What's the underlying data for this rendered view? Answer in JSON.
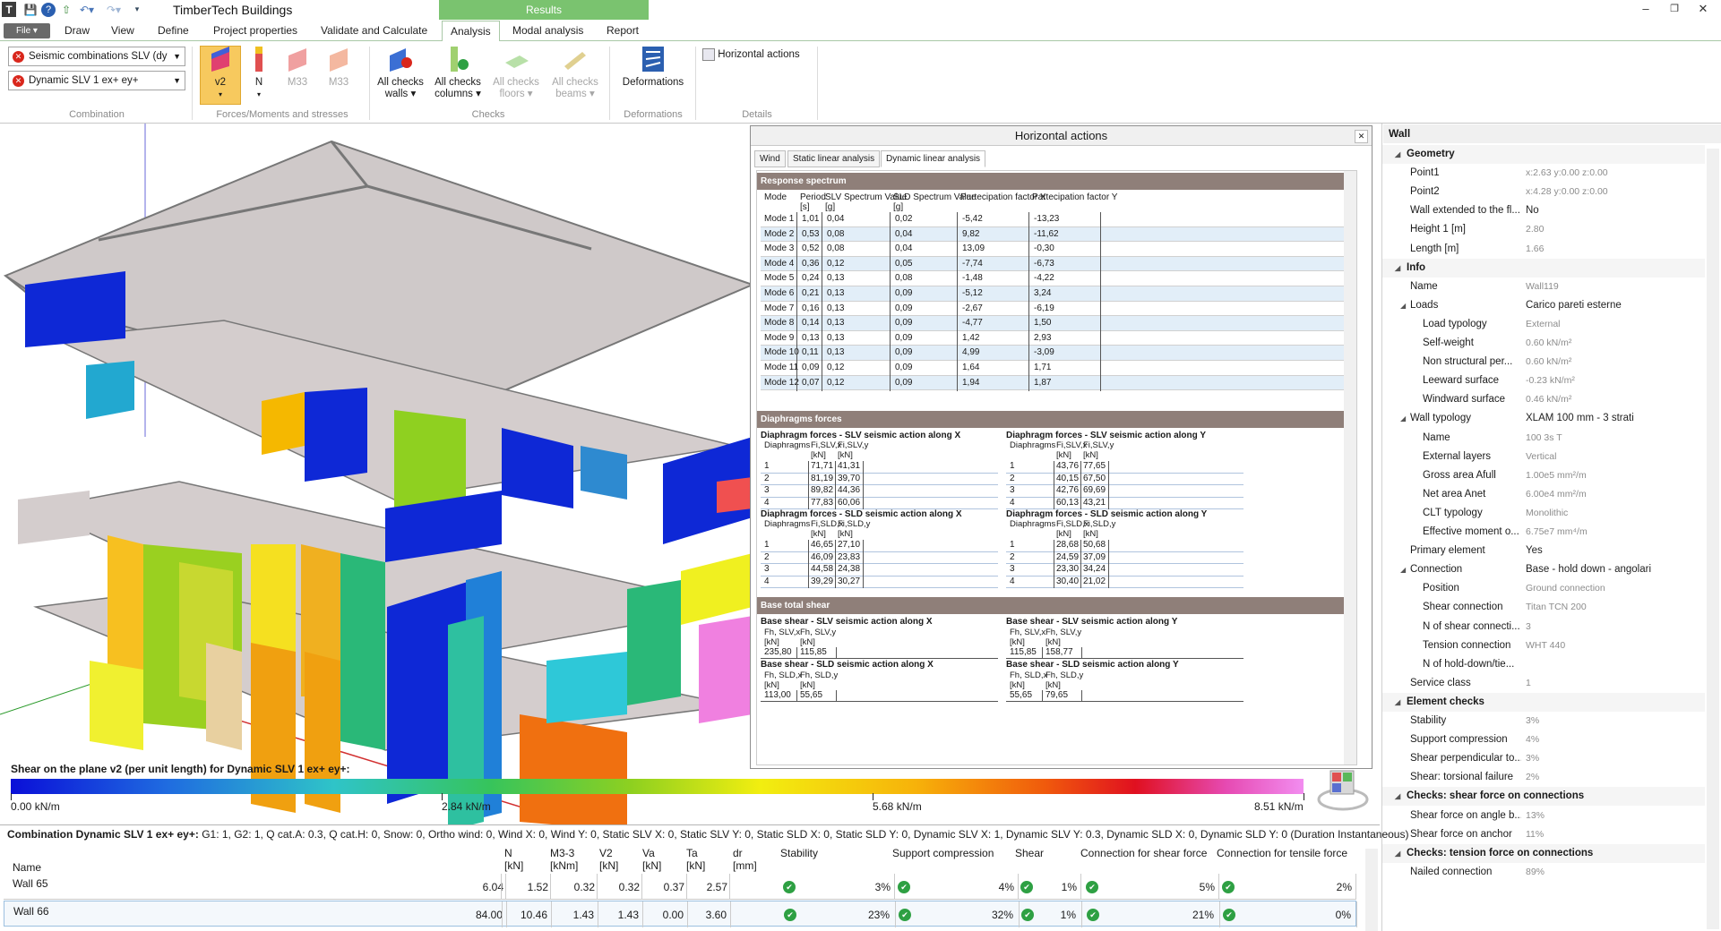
{
  "app": {
    "title": "TimberTech Buildings",
    "results_tab": "Results"
  },
  "menu": {
    "file": "File ▾",
    "tabs": [
      "Draw",
      "View",
      "Define",
      "Project properties",
      "Validate and Calculate",
      "Analysis",
      "Modal analysis",
      "Report"
    ],
    "active_tab": "Analysis"
  },
  "ribbon": {
    "combo1": "Seismic combinations SLV (dy",
    "combo2": "Dynamic SLV 1 ex+ ey+",
    "groups": {
      "combination": "Combination",
      "forces": "Forces/Moments and stresses",
      "checks": "Checks",
      "deformations": "Deformations",
      "details": "Details"
    },
    "buttons": {
      "v2": "v2",
      "n": "N",
      "m33a": "M33",
      "m33b": "M33",
      "checks_walls": "All checks walls ▾",
      "checks_columns": "All checks columns ▾",
      "checks_floors": "All checks floors ▾",
      "checks_beams": "All checks beams ▾",
      "deformations": "Deformations",
      "horizontal_actions": "Horizontal actions"
    }
  },
  "legend": {
    "title": "Shear on the plane v2 (per unit length) for Dynamic SLV 1 ex+ ey+:",
    "labels": [
      "0.00 kN/m",
      "2.84 kN/m",
      "5.68 kN/m",
      "8.51 kN/m"
    ]
  },
  "horizontal": {
    "title": "Horizontal actions",
    "tabs": [
      "Wind",
      "Static linear analysis",
      "Dynamic linear analysis"
    ],
    "response": {
      "header": "Response spectrum",
      "cols": [
        "Mode",
        "Period",
        "SLV Spectrum Value",
        "SLD Spectrum Value",
        "Partecipation factor X",
        "Partecipation factor Y"
      ],
      "units": [
        "[s]",
        "[g]",
        "[g]"
      ],
      "rows": [
        [
          "Mode 1",
          "1,01",
          "0,04",
          "0,02",
          "-5,42",
          "-13,23"
        ],
        [
          "Mode 2",
          "0,53",
          "0,08",
          "0,04",
          "9,82",
          "-11,62"
        ],
        [
          "Mode 3",
          "0,52",
          "0,08",
          "0,04",
          "13,09",
          "-0,30"
        ],
        [
          "Mode 4",
          "0,36",
          "0,12",
          "0,05",
          "-7,74",
          "-6,73"
        ],
        [
          "Mode 5",
          "0,24",
          "0,13",
          "0,08",
          "-1,48",
          "-4,22"
        ],
        [
          "Mode 6",
          "0,21",
          "0,13",
          "0,09",
          "-5,12",
          "3,24"
        ],
        [
          "Mode 7",
          "0,16",
          "0,13",
          "0,09",
          "-2,67",
          "-6,19"
        ],
        [
          "Mode 8",
          "0,14",
          "0,13",
          "0,09",
          "-4,77",
          "1,50"
        ],
        [
          "Mode 9",
          "0,13",
          "0,13",
          "0,09",
          "1,42",
          "2,93"
        ],
        [
          "Mode 10",
          "0,11",
          "0,13",
          "0,09",
          "4,99",
          "-3,09"
        ],
        [
          "Mode 11",
          "0,09",
          "0,12",
          "0,09",
          "1,64",
          "1,71"
        ],
        [
          "Mode 12",
          "0,07",
          "0,12",
          "0,09",
          "1,94",
          "1,87"
        ]
      ]
    },
    "diaphragms": {
      "header": "Diaphragms forces",
      "col_label": "Diaphragms",
      "unit": "[kN]",
      "tables": [
        {
          "title": "Diaphragm forces - SLV seismic action along X",
          "c1": "Fi,SLV,x",
          "c2": "Fi,SLV,y",
          "rows": [
            [
              "1",
              "71,71",
              "41,31"
            ],
            [
              "2",
              "81,19",
              "39,70"
            ],
            [
              "3",
              "89,82",
              "44,36"
            ],
            [
              "4",
              "77,83",
              "60,06"
            ]
          ]
        },
        {
          "title": "Diaphragm forces - SLV seismic action along Y",
          "c1": "Fi,SLV,x",
          "c2": "Fi,SLV,y",
          "rows": [
            [
              "1",
              "43,76",
              "77,65"
            ],
            [
              "2",
              "40,15",
              "67,50"
            ],
            [
              "3",
              "42,76",
              "69,69"
            ],
            [
              "4",
              "60,13",
              "43,21"
            ]
          ]
        },
        {
          "title": "Diaphragm forces - SLD seismic action along X",
          "c1": "Fi,SLD,x",
          "c2": "Fi,SLD,y",
          "rows": [
            [
              "1",
              "46,65",
              "27,10"
            ],
            [
              "2",
              "46,09",
              "23,83"
            ],
            [
              "3",
              "44,58",
              "24,38"
            ],
            [
              "4",
              "39,29",
              "30,27"
            ]
          ]
        },
        {
          "title": "Diaphragm forces - SLD seismic action along Y",
          "c1": "Fi,SLD,x",
          "c2": "Fi,SLD,y",
          "rows": [
            [
              "1",
              "28,68",
              "50,68"
            ],
            [
              "2",
              "24,59",
              "37,09"
            ],
            [
              "3",
              "23,30",
              "34,24"
            ],
            [
              "4",
              "30,40",
              "21,02"
            ]
          ]
        }
      ]
    },
    "base": {
      "header": "Base total shear",
      "unit": "[kN]",
      "tables": [
        {
          "title": "Base shear - SLV seismic action along X",
          "c1": "Fh, SLV,x",
          "c2": "Fh, SLV,y",
          "v1": "235,80",
          "v2": "115,85"
        },
        {
          "title": "Base shear - SLV seismic action along Y",
          "c1": "Fh, SLV,x",
          "c2": "Fh, SLV,y",
          "v1": "115,85",
          "v2": "158,77"
        },
        {
          "title": "Base shear - SLD seismic action along X",
          "c1": "Fh, SLD,x",
          "c2": "Fh, SLD,y",
          "v1": "113,00",
          "v2": "55,65"
        },
        {
          "title": "Base shear - SLD seismic action along Y",
          "c1": "Fh, SLD,x",
          "c2": "Fh, SLD,y",
          "v1": "55,65",
          "v2": "79,65"
        }
      ]
    }
  },
  "props": {
    "title": "Wall",
    "rows": [
      {
        "t": "cat",
        "n": "Geometry"
      },
      {
        "n": "Point1",
        "v": "x:2.63 y:0.00 z:0.00"
      },
      {
        "n": "Point2",
        "v": "x:4.28 y:0.00 z:0.00"
      },
      {
        "n": "Wall extended to the fl...",
        "v": "No",
        "d": true
      },
      {
        "n": "Height 1 [m]",
        "v": "2.80"
      },
      {
        "n": "Length [m]",
        "v": "1.66"
      },
      {
        "t": "cat",
        "n": "Info"
      },
      {
        "n": "Name",
        "v": "Wall119"
      },
      {
        "t": "sub",
        "n": "Loads",
        "v": "Carico pareti esterne",
        "d": true
      },
      {
        "t": "i2",
        "n": "Load typology",
        "v": "External"
      },
      {
        "t": "i2",
        "n": "Self-weight",
        "v": "0.60 kN/m²"
      },
      {
        "t": "i2",
        "n": "Non structural per...",
        "v": "0.60 kN/m²"
      },
      {
        "t": "i2",
        "n": "Leeward surface",
        "v": "-0.23 kN/m²"
      },
      {
        "t": "i2",
        "n": "Windward surface",
        "v": "0.46 kN/m²"
      },
      {
        "t": "sub",
        "n": "Wall typology",
        "v": "XLAM 100 mm - 3 strati",
        "d": true
      },
      {
        "t": "i2",
        "n": "Name",
        "v": "100 3s T"
      },
      {
        "t": "i2",
        "n": "External layers",
        "v": "Vertical"
      },
      {
        "t": "i2",
        "n": "Gross area Afull",
        "v": "1.00e5 mm²/m"
      },
      {
        "t": "i2",
        "n": "Net area Anet",
        "v": "6.00e4 mm²/m"
      },
      {
        "t": "i2",
        "n": "CLT typology",
        "v": "Monolithic"
      },
      {
        "t": "i2",
        "n": "Effective moment o...",
        "v": "6.75e7 mm⁴/m"
      },
      {
        "n": "Primary element",
        "v": "Yes",
        "d": true
      },
      {
        "t": "sub",
        "n": "Connection",
        "v": "Base - hold down - angolari",
        "d": true
      },
      {
        "t": "i2",
        "n": "Position",
        "v": "Ground connection"
      },
      {
        "t": "i2",
        "n": "Shear connection",
        "v": "Titan TCN 200"
      },
      {
        "t": "i2",
        "n": "N of shear connecti...",
        "v": "3"
      },
      {
        "t": "i2",
        "n": "Tension connection",
        "v": "WHT 440"
      },
      {
        "t": "i2",
        "n": "N of hold-down/tie...",
        "v": ""
      },
      {
        "n": "Service class",
        "v": "1"
      },
      {
        "t": "cat",
        "n": "Element checks"
      },
      {
        "n": "Stability",
        "v": "3%"
      },
      {
        "n": "Support compression",
        "v": "4%"
      },
      {
        "n": "Shear perpendicular to...",
        "v": "3%"
      },
      {
        "n": "Shear: torsional failure",
        "v": "2%"
      },
      {
        "t": "cat",
        "n": "Checks: shear force on connections"
      },
      {
        "n": "Shear force on angle b...",
        "v": "13%"
      },
      {
        "n": "Shear force on anchor",
        "v": "11%"
      },
      {
        "t": "cat",
        "n": "Checks: tension force on connections"
      },
      {
        "n": "Nailed connection",
        "v": "89%"
      }
    ]
  },
  "bottom": {
    "combination_label": "Combination Dynamic SLV 1 ex+ ey+:",
    "combination_text": "G1: 1, G2: 1, Q cat.A: 0.3, Q cat.H: 0, Snow: 0, Ortho wind: 0, Wind X: 0, Wind Y: 0, Static SLV X: 0, Static SLV Y: 0, Static SLD X: 0, Static SLD Y: 0, Dynamic SLV X: 1, Dynamic SLV Y: 0.3, Dynamic SLD X: 0, Dynamic SLD Y: 0 (Duration Instantaneous)",
    "headers": [
      {
        "t": "Name",
        "u": ""
      },
      {
        "t": "N",
        "u": "[kN]"
      },
      {
        "t": "M3-3",
        "u": "[kNm]"
      },
      {
        "t": "V2",
        "u": "[kN]"
      },
      {
        "t": "Va",
        "u": "[kN]"
      },
      {
        "t": "Ta",
        "u": "[kN]"
      },
      {
        "t": "dr",
        "u": "[mm]"
      },
      {
        "t": "Stability",
        "u": ""
      },
      {
        "t": "Support compression",
        "u": ""
      },
      {
        "t": "Shear",
        "u": ""
      },
      {
        "t": "Connection for shear force",
        "u": ""
      },
      {
        "t": "Connection for tensile force",
        "u": ""
      }
    ],
    "rows": [
      {
        "name": "Wall 65",
        "n": "6.04",
        "m": "1.52",
        "v2": "0.32",
        "va": "0.32",
        "ta": "0.37",
        "dr": "2.57",
        "stab": "3%",
        "sc": "4%",
        "sh": "1%",
        "csf": "5%",
        "ctf": "2%"
      },
      {
        "name": "Wall 66",
        "n": "84.00",
        "m": "10.46",
        "v2": "1.43",
        "va": "1.43",
        "ta": "0.00",
        "dr": "3.60",
        "stab": "23%",
        "sc": "32%",
        "sh": "1%",
        "csf": "21%",
        "ctf": "0%"
      }
    ]
  }
}
